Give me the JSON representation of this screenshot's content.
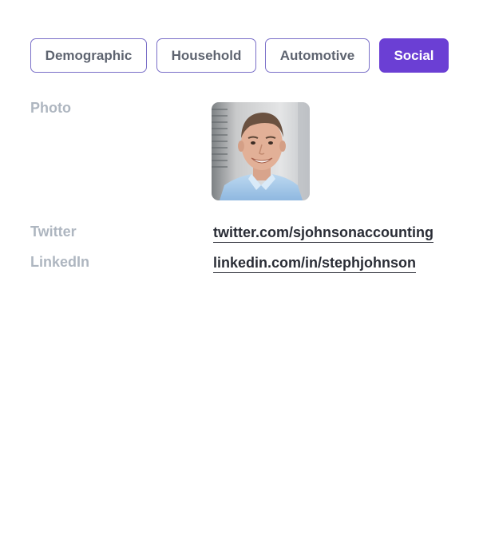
{
  "tabs": [
    {
      "label": "Demographic",
      "active": false
    },
    {
      "label": "Household",
      "active": false
    },
    {
      "label": "Automotive",
      "active": false
    },
    {
      "label": "Social",
      "active": true
    }
  ],
  "fields": {
    "photo_label": "Photo",
    "twitter_label": "Twitter",
    "twitter_value": "twitter.com/sjohnsonaccounting",
    "linkedin_label": "LinkedIn",
    "linkedin_value": "linkedin.com/in/stephjohnson"
  },
  "colors": {
    "accent": "#6b3fd4",
    "tab_border": "#7a6fc8",
    "label": "#aeb6c0",
    "link": "#2a2d36"
  }
}
